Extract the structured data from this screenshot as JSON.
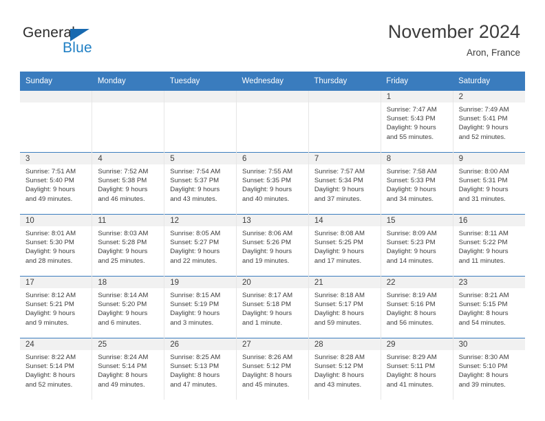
{
  "brand": {
    "name_part1": "General",
    "name_part2": "Blue",
    "triangle_color": "#1769b0",
    "blue_color": "#1f7fc4"
  },
  "header": {
    "title": "November 2024",
    "subtitle": "Aron, France"
  },
  "theme": {
    "header_row_bg": "#3a7cbe",
    "daynum_band_bg": "#f1f1f1",
    "text_color": "#3c3c3c",
    "cell_divider": "#e6e6e6"
  },
  "weekday_headers": [
    "Sunday",
    "Monday",
    "Tuesday",
    "Wednesday",
    "Thursday",
    "Friday",
    "Saturday"
  ],
  "labels": {
    "sunrise_prefix": "Sunrise: ",
    "sunset_prefix": "Sunset: ",
    "daylight_prefix": "Daylight: "
  },
  "weeks": [
    [
      {
        "day": "",
        "sunrise": "",
        "sunset": "",
        "daylight_line1": "",
        "daylight_line2": "",
        "empty": true
      },
      {
        "day": "",
        "sunrise": "",
        "sunset": "",
        "daylight_line1": "",
        "daylight_line2": "",
        "empty": true
      },
      {
        "day": "",
        "sunrise": "",
        "sunset": "",
        "daylight_line1": "",
        "daylight_line2": "",
        "empty": true
      },
      {
        "day": "",
        "sunrise": "",
        "sunset": "",
        "daylight_line1": "",
        "daylight_line2": "",
        "empty": true
      },
      {
        "day": "",
        "sunrise": "",
        "sunset": "",
        "daylight_line1": "",
        "daylight_line2": "",
        "empty": true
      },
      {
        "day": "1",
        "sunrise": "Sunrise: 7:47 AM",
        "sunset": "Sunset: 5:43 PM",
        "daylight_line1": "Daylight: 9 hours",
        "daylight_line2": "and 55 minutes.",
        "empty": false
      },
      {
        "day": "2",
        "sunrise": "Sunrise: 7:49 AM",
        "sunset": "Sunset: 5:41 PM",
        "daylight_line1": "Daylight: 9 hours",
        "daylight_line2": "and 52 minutes.",
        "empty": false
      }
    ],
    [
      {
        "day": "3",
        "sunrise": "Sunrise: 7:51 AM",
        "sunset": "Sunset: 5:40 PM",
        "daylight_line1": "Daylight: 9 hours",
        "daylight_line2": "and 49 minutes.",
        "empty": false
      },
      {
        "day": "4",
        "sunrise": "Sunrise: 7:52 AM",
        "sunset": "Sunset: 5:38 PM",
        "daylight_line1": "Daylight: 9 hours",
        "daylight_line2": "and 46 minutes.",
        "empty": false
      },
      {
        "day": "5",
        "sunrise": "Sunrise: 7:54 AM",
        "sunset": "Sunset: 5:37 PM",
        "daylight_line1": "Daylight: 9 hours",
        "daylight_line2": "and 43 minutes.",
        "empty": false
      },
      {
        "day": "6",
        "sunrise": "Sunrise: 7:55 AM",
        "sunset": "Sunset: 5:35 PM",
        "daylight_line1": "Daylight: 9 hours",
        "daylight_line2": "and 40 minutes.",
        "empty": false
      },
      {
        "day": "7",
        "sunrise": "Sunrise: 7:57 AM",
        "sunset": "Sunset: 5:34 PM",
        "daylight_line1": "Daylight: 9 hours",
        "daylight_line2": "and 37 minutes.",
        "empty": false
      },
      {
        "day": "8",
        "sunrise": "Sunrise: 7:58 AM",
        "sunset": "Sunset: 5:33 PM",
        "daylight_line1": "Daylight: 9 hours",
        "daylight_line2": "and 34 minutes.",
        "empty": false
      },
      {
        "day": "9",
        "sunrise": "Sunrise: 8:00 AM",
        "sunset": "Sunset: 5:31 PM",
        "daylight_line1": "Daylight: 9 hours",
        "daylight_line2": "and 31 minutes.",
        "empty": false
      }
    ],
    [
      {
        "day": "10",
        "sunrise": "Sunrise: 8:01 AM",
        "sunset": "Sunset: 5:30 PM",
        "daylight_line1": "Daylight: 9 hours",
        "daylight_line2": "and 28 minutes.",
        "empty": false
      },
      {
        "day": "11",
        "sunrise": "Sunrise: 8:03 AM",
        "sunset": "Sunset: 5:28 PM",
        "daylight_line1": "Daylight: 9 hours",
        "daylight_line2": "and 25 minutes.",
        "empty": false
      },
      {
        "day": "12",
        "sunrise": "Sunrise: 8:05 AM",
        "sunset": "Sunset: 5:27 PM",
        "daylight_line1": "Daylight: 9 hours",
        "daylight_line2": "and 22 minutes.",
        "empty": false
      },
      {
        "day": "13",
        "sunrise": "Sunrise: 8:06 AM",
        "sunset": "Sunset: 5:26 PM",
        "daylight_line1": "Daylight: 9 hours",
        "daylight_line2": "and 19 minutes.",
        "empty": false
      },
      {
        "day": "14",
        "sunrise": "Sunrise: 8:08 AM",
        "sunset": "Sunset: 5:25 PM",
        "daylight_line1": "Daylight: 9 hours",
        "daylight_line2": "and 17 minutes.",
        "empty": false
      },
      {
        "day": "15",
        "sunrise": "Sunrise: 8:09 AM",
        "sunset": "Sunset: 5:23 PM",
        "daylight_line1": "Daylight: 9 hours",
        "daylight_line2": "and 14 minutes.",
        "empty": false
      },
      {
        "day": "16",
        "sunrise": "Sunrise: 8:11 AM",
        "sunset": "Sunset: 5:22 PM",
        "daylight_line1": "Daylight: 9 hours",
        "daylight_line2": "and 11 minutes.",
        "empty": false
      }
    ],
    [
      {
        "day": "17",
        "sunrise": "Sunrise: 8:12 AM",
        "sunset": "Sunset: 5:21 PM",
        "daylight_line1": "Daylight: 9 hours",
        "daylight_line2": "and 9 minutes.",
        "empty": false
      },
      {
        "day": "18",
        "sunrise": "Sunrise: 8:14 AM",
        "sunset": "Sunset: 5:20 PM",
        "daylight_line1": "Daylight: 9 hours",
        "daylight_line2": "and 6 minutes.",
        "empty": false
      },
      {
        "day": "19",
        "sunrise": "Sunrise: 8:15 AM",
        "sunset": "Sunset: 5:19 PM",
        "daylight_line1": "Daylight: 9 hours",
        "daylight_line2": "and 3 minutes.",
        "empty": false
      },
      {
        "day": "20",
        "sunrise": "Sunrise: 8:17 AM",
        "sunset": "Sunset: 5:18 PM",
        "daylight_line1": "Daylight: 9 hours",
        "daylight_line2": "and 1 minute.",
        "empty": false
      },
      {
        "day": "21",
        "sunrise": "Sunrise: 8:18 AM",
        "sunset": "Sunset: 5:17 PM",
        "daylight_line1": "Daylight: 8 hours",
        "daylight_line2": "and 59 minutes.",
        "empty": false
      },
      {
        "day": "22",
        "sunrise": "Sunrise: 8:19 AM",
        "sunset": "Sunset: 5:16 PM",
        "daylight_line1": "Daylight: 8 hours",
        "daylight_line2": "and 56 minutes.",
        "empty": false
      },
      {
        "day": "23",
        "sunrise": "Sunrise: 8:21 AM",
        "sunset": "Sunset: 5:15 PM",
        "daylight_line1": "Daylight: 8 hours",
        "daylight_line2": "and 54 minutes.",
        "empty": false
      }
    ],
    [
      {
        "day": "24",
        "sunrise": "Sunrise: 8:22 AM",
        "sunset": "Sunset: 5:14 PM",
        "daylight_line1": "Daylight: 8 hours",
        "daylight_line2": "and 52 minutes.",
        "empty": false
      },
      {
        "day": "25",
        "sunrise": "Sunrise: 8:24 AM",
        "sunset": "Sunset: 5:14 PM",
        "daylight_line1": "Daylight: 8 hours",
        "daylight_line2": "and 49 minutes.",
        "empty": false
      },
      {
        "day": "26",
        "sunrise": "Sunrise: 8:25 AM",
        "sunset": "Sunset: 5:13 PM",
        "daylight_line1": "Daylight: 8 hours",
        "daylight_line2": "and 47 minutes.",
        "empty": false
      },
      {
        "day": "27",
        "sunrise": "Sunrise: 8:26 AM",
        "sunset": "Sunset: 5:12 PM",
        "daylight_line1": "Daylight: 8 hours",
        "daylight_line2": "and 45 minutes.",
        "empty": false
      },
      {
        "day": "28",
        "sunrise": "Sunrise: 8:28 AM",
        "sunset": "Sunset: 5:12 PM",
        "daylight_line1": "Daylight: 8 hours",
        "daylight_line2": "and 43 minutes.",
        "empty": false
      },
      {
        "day": "29",
        "sunrise": "Sunrise: 8:29 AM",
        "sunset": "Sunset: 5:11 PM",
        "daylight_line1": "Daylight: 8 hours",
        "daylight_line2": "and 41 minutes.",
        "empty": false
      },
      {
        "day": "30",
        "sunrise": "Sunrise: 8:30 AM",
        "sunset": "Sunset: 5:10 PM",
        "daylight_line1": "Daylight: 8 hours",
        "daylight_line2": "and 39 minutes.",
        "empty": false
      }
    ]
  ]
}
